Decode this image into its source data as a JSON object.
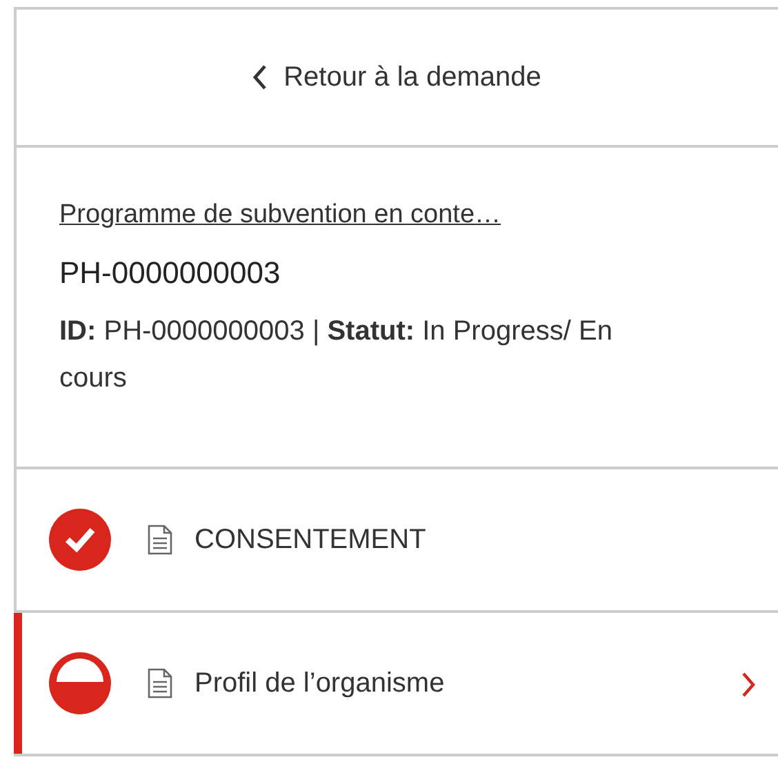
{
  "back_link": {
    "label": "Retour à la demande"
  },
  "application": {
    "program_link": "Programme de subvention en conte…",
    "number": "PH-0000000003",
    "status_line": "**ID:** PH-0000000003 | **Statut:** In Progress/ En cours"
  },
  "steps": [
    {
      "label": "CONSENTEMENT",
      "kind": "complete",
      "selected": false
    },
    {
      "label": "Profil de l’organisme",
      "kind": "partial",
      "selected": true
    }
  ]
}
